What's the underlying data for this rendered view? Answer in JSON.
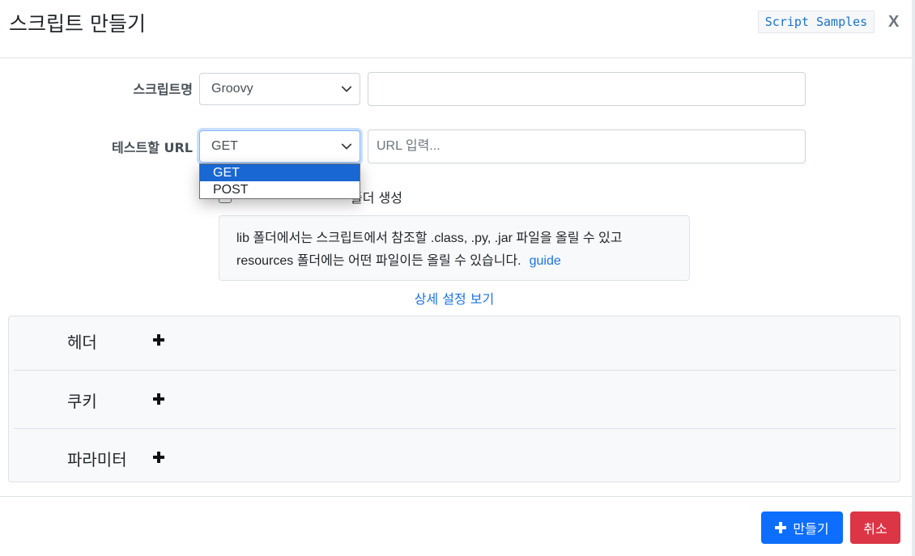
{
  "header": {
    "title": "스크립트 만들기",
    "samples_label": "Script Samples",
    "close_label": "X"
  },
  "form": {
    "name_label": "스크립트명",
    "language_value": "Groovy",
    "name_value": "",
    "url_label": "테스트할 URL",
    "method_value": "GET",
    "url_placeholder": "URL 입력...",
    "method_options": [
      "GET",
      "POST"
    ],
    "method_selected": "GET",
    "checkbox_label": "폴더 생성",
    "info_line1": "lib 폴더에서는 스크립트에서 참조할 .class, .py, .jar 파일을 올릴 수 있고",
    "info_line2": "resources 폴더에는 어떤 파일이든 올릴 수 있습니다.",
    "guide_label": "guide",
    "details_link": "상세 설정 보기"
  },
  "sections": [
    {
      "title": "헤더"
    },
    {
      "title": "쿠키"
    },
    {
      "title": "파라미터"
    }
  ],
  "footer": {
    "create_label": "만들기",
    "cancel_label": "취소"
  },
  "icons": [
    "chevron-down-icon",
    "plus-icon",
    "close-icon"
  ],
  "colors": {
    "primary": "#0d6efd",
    "danger": "#dc3545",
    "link": "#1a73e8",
    "option_highlight": "#1967d2"
  }
}
